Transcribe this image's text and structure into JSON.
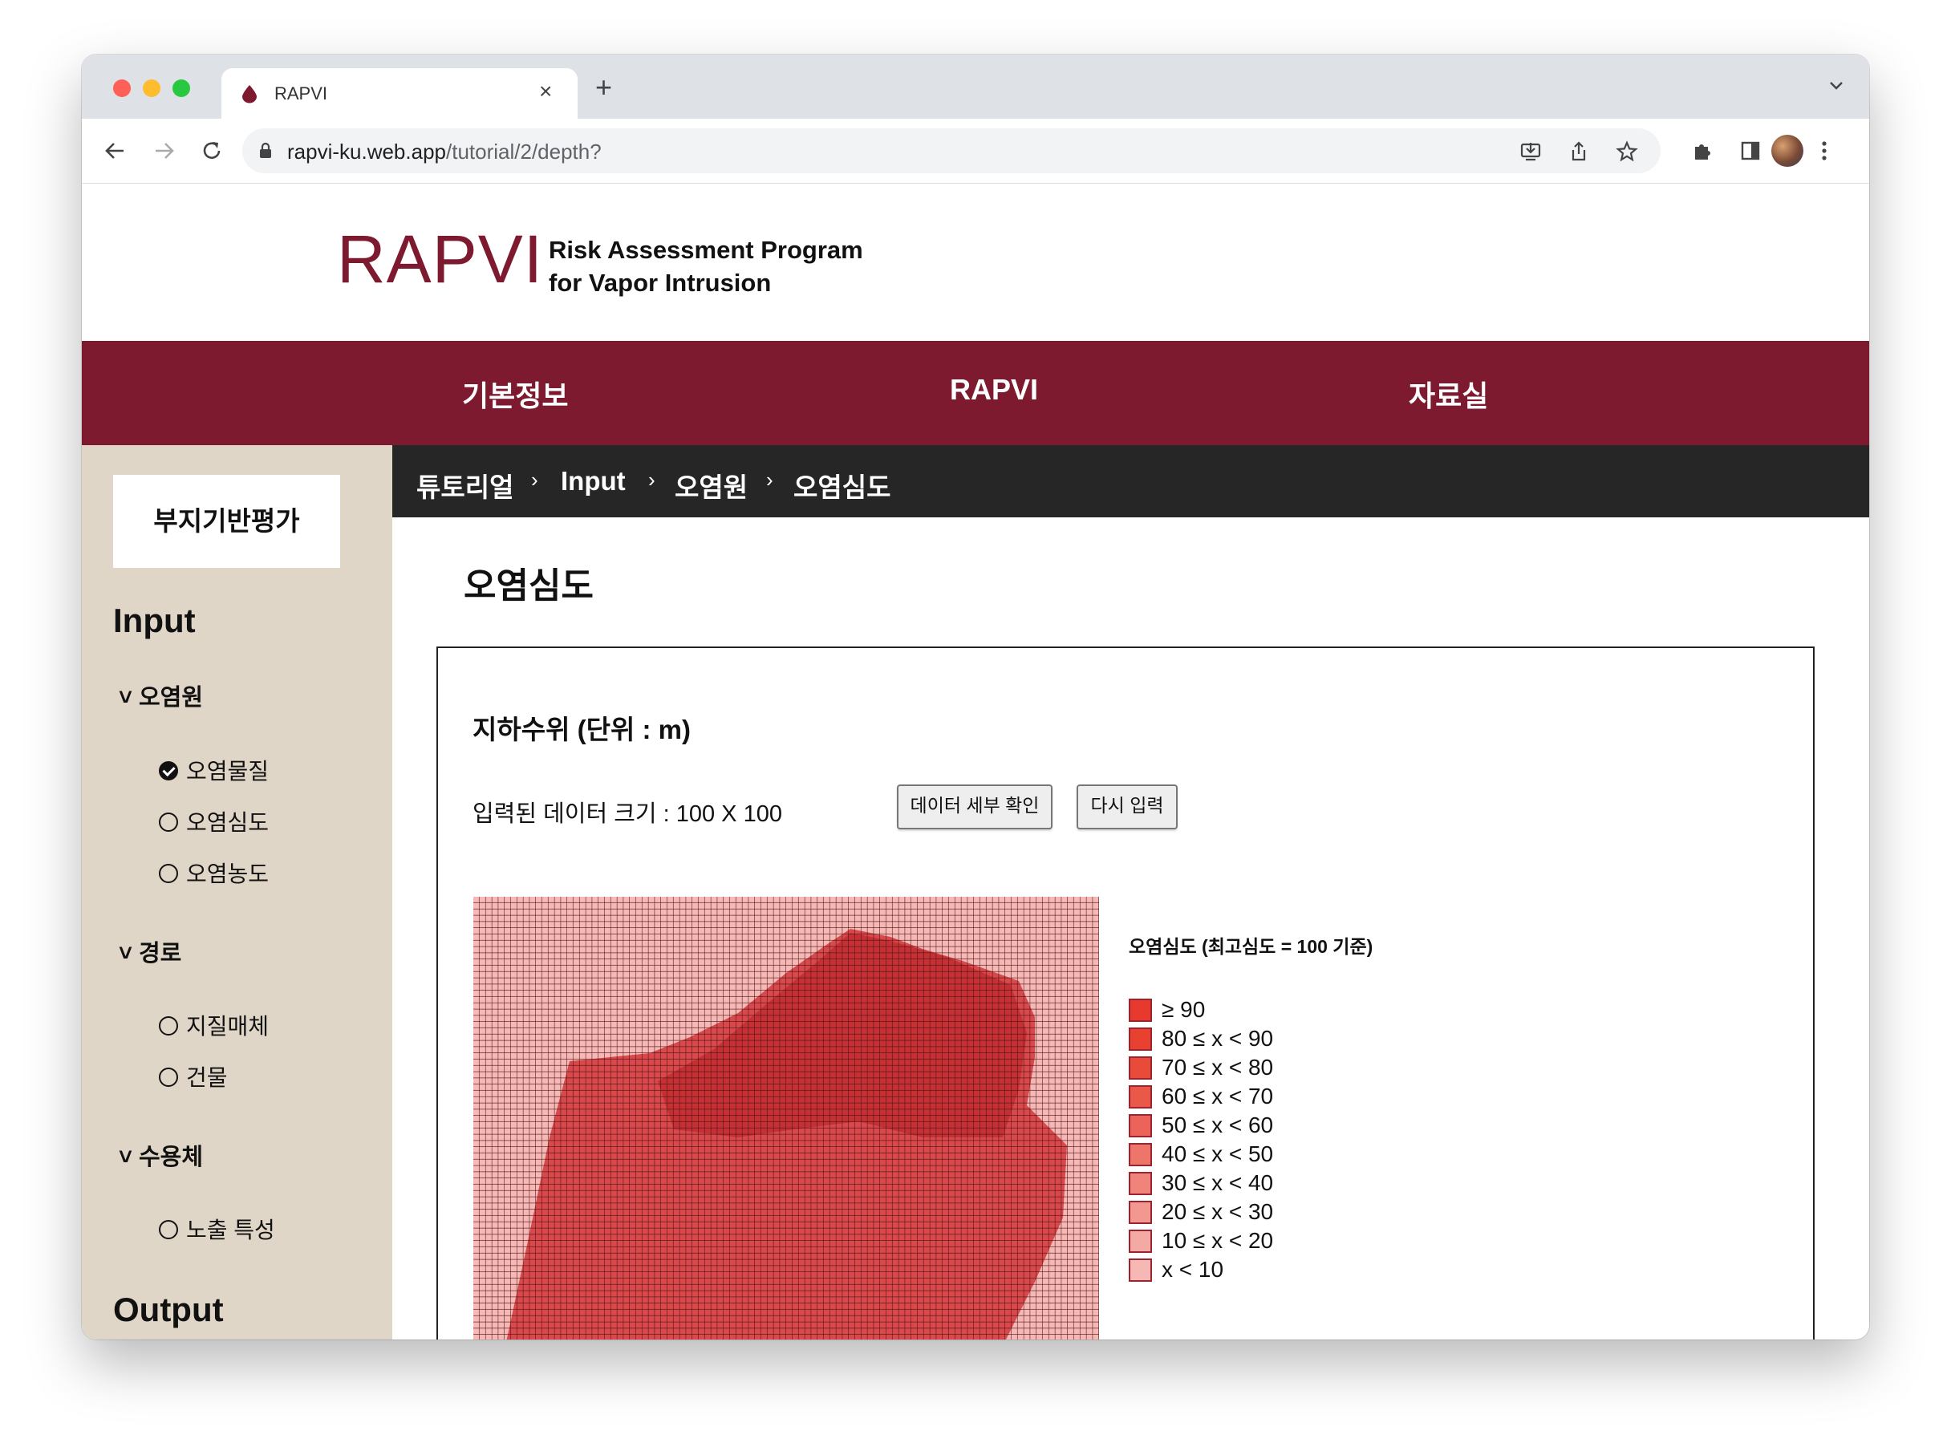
{
  "browser": {
    "tab_title": "RAPVI",
    "url_host": "rapvi-ku.web.app",
    "url_path": "/tutorial/2/depth?",
    "traffic_lights": [
      "#fe5f57",
      "#febc2e",
      "#28c840"
    ]
  },
  "header": {
    "logo": "RAPVI",
    "subtitle_line1": "Risk Assessment Program",
    "subtitle_line2": "for Vapor Intrusion",
    "brand_color": "#7e1a30"
  },
  "main_nav": {
    "items": [
      "기본정보",
      "RAPVI",
      "자료실"
    ]
  },
  "sidebar": {
    "top_button": "부지기반평가",
    "input_heading": "Input",
    "groups": [
      {
        "label": "오염원",
        "items": [
          {
            "label": "오염물질",
            "checked": true
          },
          {
            "label": "오염심도",
            "checked": false
          },
          {
            "label": "오염농도",
            "checked": false
          }
        ]
      },
      {
        "label": "경로",
        "items": [
          {
            "label": "지질매체",
            "checked": false
          },
          {
            "label": "건물",
            "checked": false
          }
        ]
      },
      {
        "label": "수용체",
        "items": [
          {
            "label": "노출 특성",
            "checked": false
          }
        ]
      }
    ],
    "output_heading": "Output"
  },
  "breadcrumb": [
    "튜토리얼",
    "Input",
    "오염원",
    "오염심도"
  ],
  "main": {
    "page_title": "오염심도",
    "section_title": "지하수위 (단위 : m)",
    "data_size_label": "입력된 데이터 크기 : 100 X 100",
    "detail_button": "데이터 세부 확인",
    "reset_button": "다시 입력"
  },
  "legend": {
    "title": "오염심도 (최고심도 = 100 기준)",
    "items": [
      {
        "label": "≥ 90",
        "color": "#e8392e"
      },
      {
        "label": "80 ≤ x < 90",
        "color": "#e8412f"
      },
      {
        "label": "70 ≤ x < 80",
        "color": "#e94b3a"
      },
      {
        "label": "60 ≤ x < 70",
        "color": "#ea5848"
      },
      {
        "label": "50 ≤ x < 60",
        "color": "#ec6459"
      },
      {
        "label": "40 ≤ x < 50",
        "color": "#ee7569"
      },
      {
        "label": "30 ≤ x < 40",
        "color": "#f0847a"
      },
      {
        "label": "20 ≤ x < 30",
        "color": "#f29890"
      },
      {
        "label": "10 ≤ x < 20",
        "color": "#f3aaa4"
      },
      {
        "label": "x < 10",
        "color": "#f5b8b4"
      }
    ]
  },
  "heatmap": {
    "grid_size": [
      100,
      100
    ],
    "background_color": "#f5b8b4",
    "region_colors": [
      "#d9484a",
      "#c53034"
    ]
  }
}
